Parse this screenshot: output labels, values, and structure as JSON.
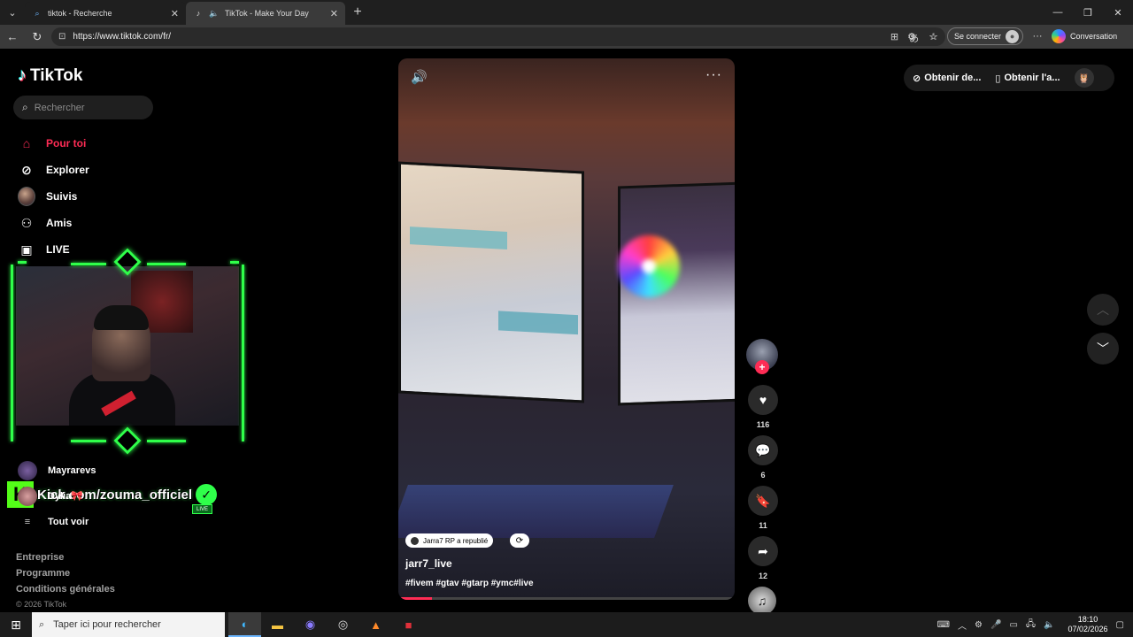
{
  "browser": {
    "tabs": [
      {
        "title": "tiktok - Recherche",
        "icon": "search-icon"
      },
      {
        "title": "TikTok - Make Your Day",
        "icon": "tiktok-icon"
      }
    ],
    "url": "https://www.tiktok.com/fr/",
    "signin_label": "Se connecter",
    "copilot_label": "Conversation"
  },
  "tiktok": {
    "logo_text": "TikTok",
    "search_placeholder": "Rechercher",
    "nav": [
      {
        "label": "Pour toi",
        "icon": "home-icon"
      },
      {
        "label": "Explorer",
        "icon": "compass-icon"
      },
      {
        "label": "Suivis",
        "icon": "avatar"
      },
      {
        "label": "Amis",
        "icon": "friends-icon"
      },
      {
        "label": "LIVE",
        "icon": "live-tv-icon"
      }
    ],
    "following": [
      {
        "label": "Mayrarevs"
      },
      {
        "label": "Dylia🎀"
      }
    ],
    "see_all": "Tout voir",
    "footer": [
      "Entreprise",
      "Programme",
      "Conditions générales"
    ],
    "copyright": "© 2026 TikTok",
    "top_right": {
      "coins": "Obtenir de...",
      "app": "Obtenir l'a..."
    }
  },
  "stream_overlay": {
    "kick_text": "Kick.com/zouma_officiel",
    "live_badge": "LIVE"
  },
  "video": {
    "repost_text": "Jarra7 RP a republié",
    "author": "jarr7_live",
    "hashtags": "#fivem #gtav #gtarp #ymc#live",
    "progress": 0.1,
    "likes": "116",
    "comments": "6",
    "saves": "11",
    "shares": "12"
  },
  "taskbar": {
    "search_placeholder": "Taper ici pour rechercher",
    "time": "18:10",
    "date": "07/02/2026"
  }
}
